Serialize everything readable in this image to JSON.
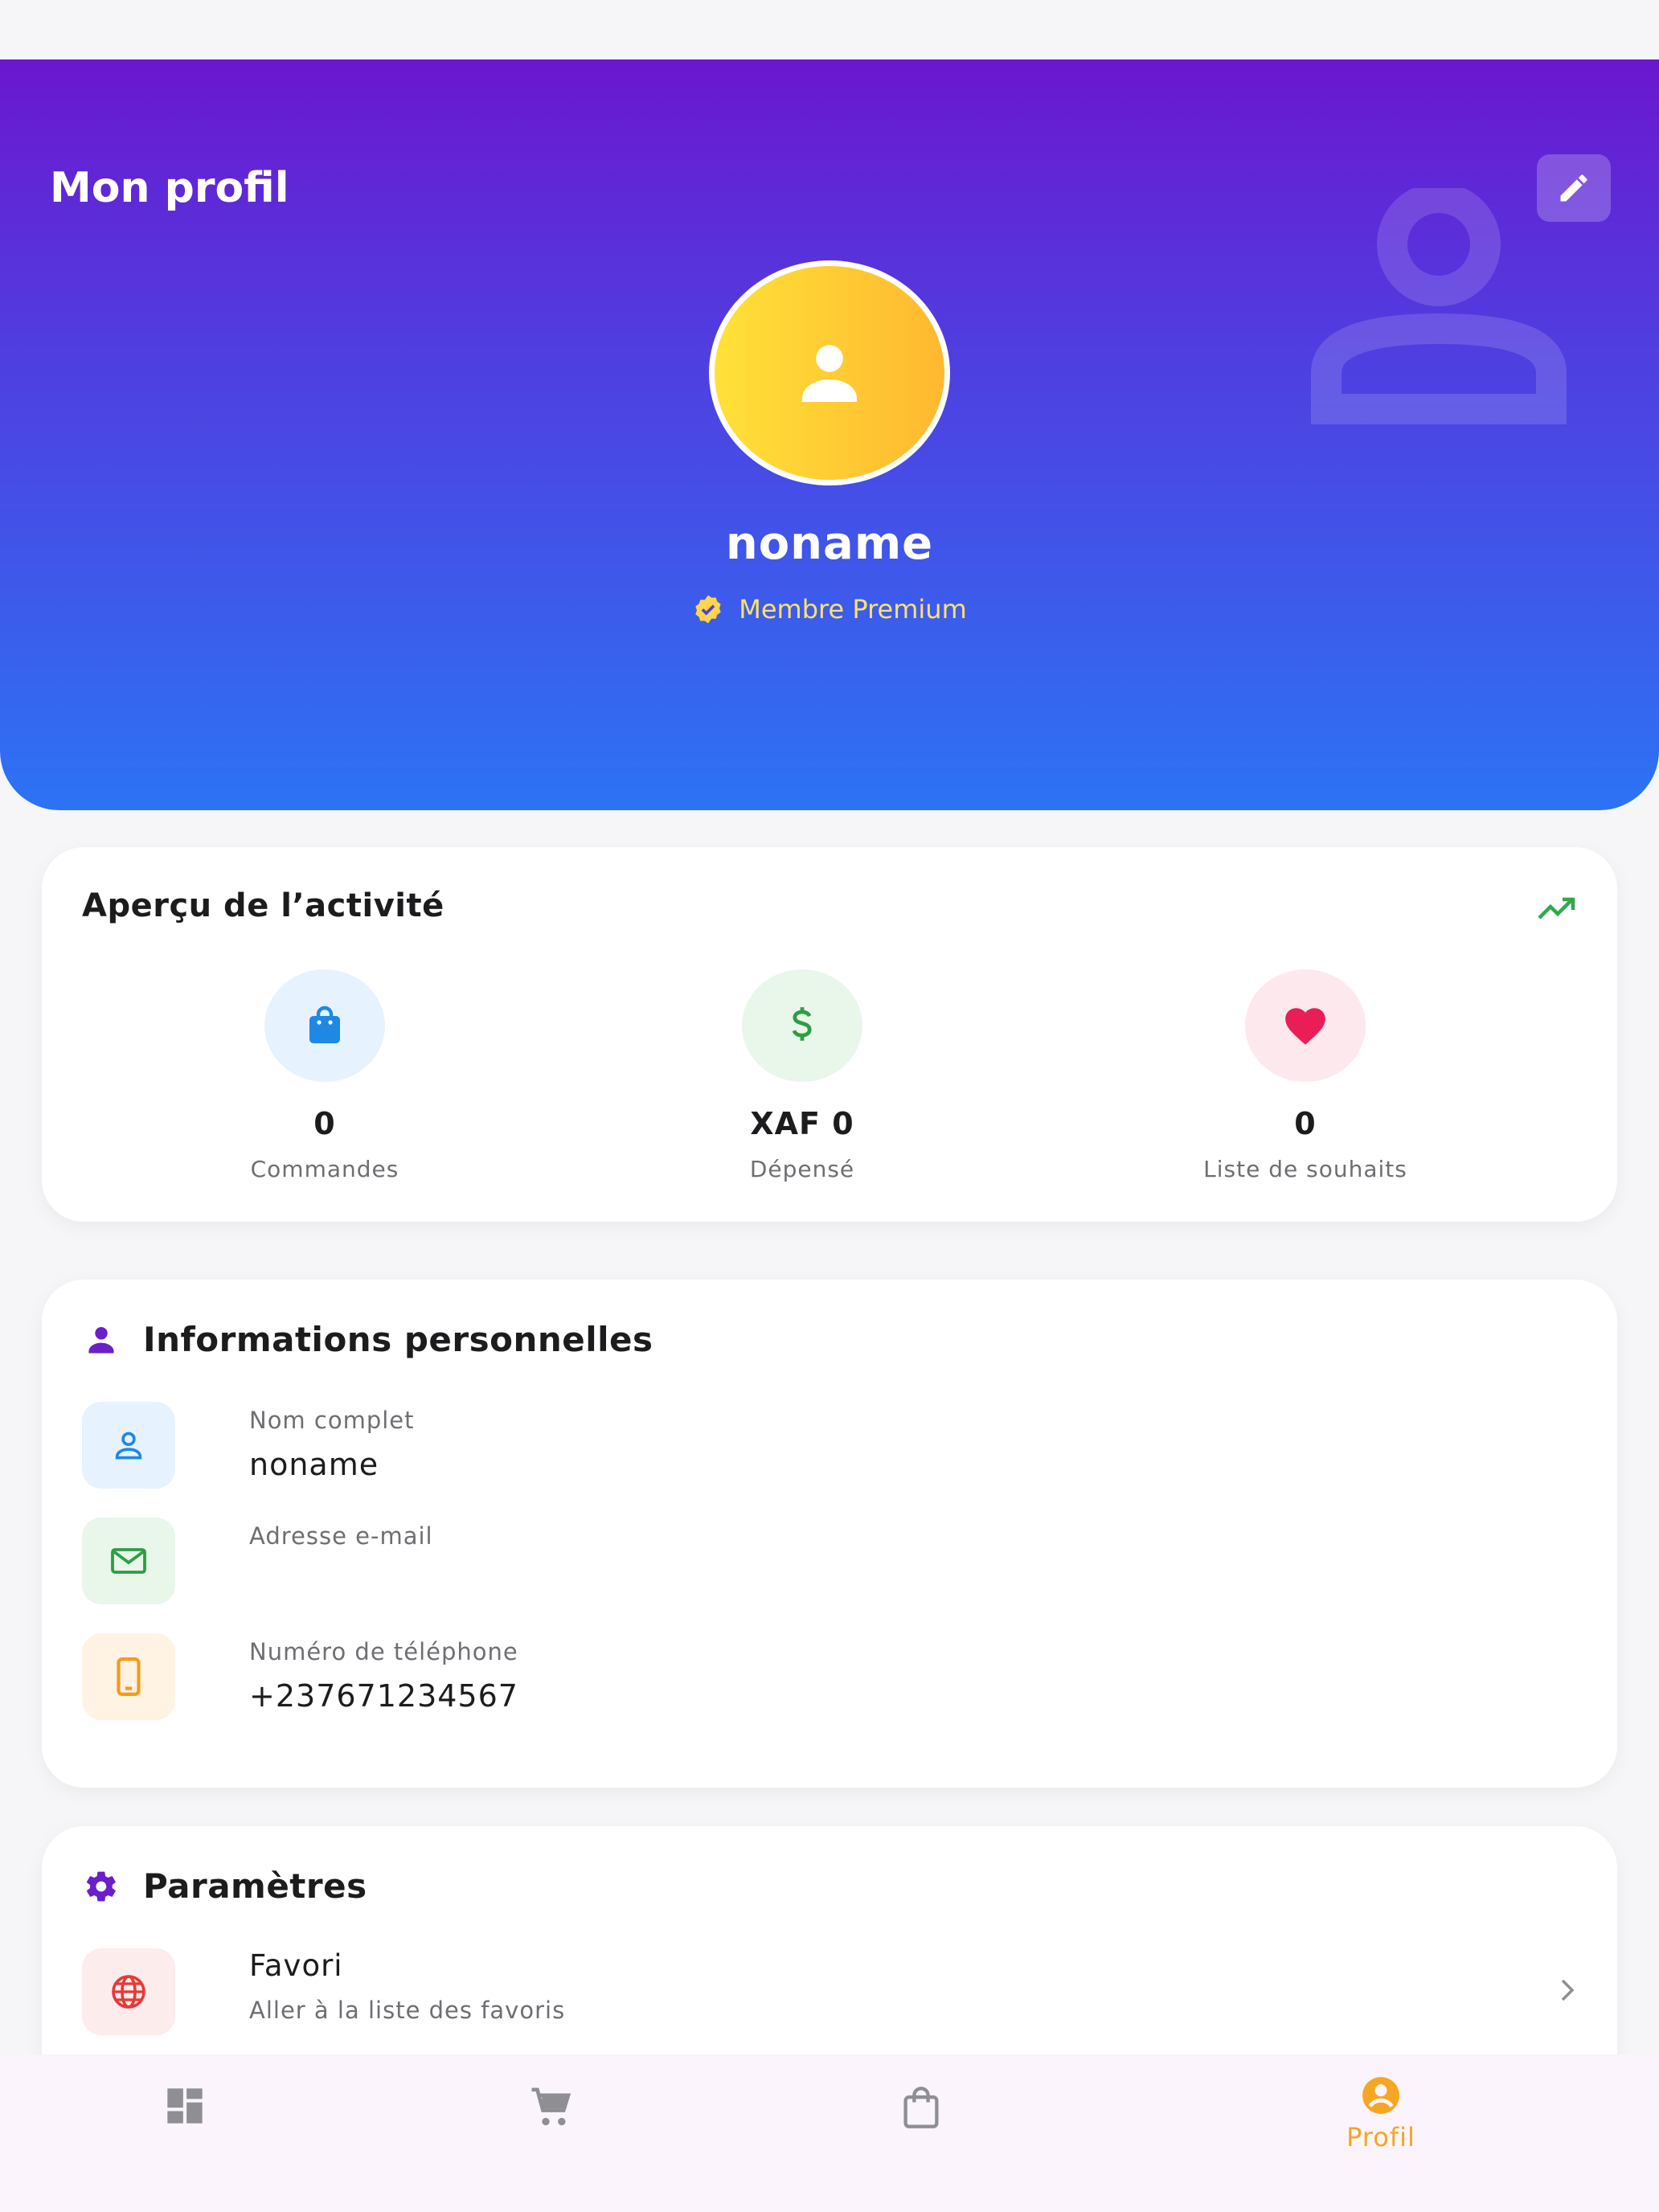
{
  "colors": {
    "header_gradient_top": "#6b17cf",
    "header_gradient_bottom": "#2c73f5",
    "accent_purple": "#6a1fc9",
    "premium_gold": "#ffe26a",
    "nav_active": "#f5a623"
  },
  "header": {
    "title": "Mon profil",
    "edit_icon": "pencil-icon",
    "username": "noname",
    "badge": "Membre Premium",
    "badge_icon": "verified-icon"
  },
  "activity": {
    "title": "Aperçu de l’activité",
    "trend_icon": "trending-up-icon",
    "stats": [
      {
        "icon": "shopping-bag-icon",
        "value": "0",
        "label": "Commandes"
      },
      {
        "icon": "dollar-icon",
        "value": "XAF 0",
        "label": "Dépensé"
      },
      {
        "icon": "heart-icon",
        "value": "0",
        "label": "Liste de souhaits"
      }
    ]
  },
  "info": {
    "title": "Informations personnelles",
    "rows": [
      {
        "icon": "person-icon",
        "label": "Nom complet",
        "value": "noname"
      },
      {
        "icon": "mail-icon",
        "label": "Adresse e-mail",
        "value": ""
      },
      {
        "icon": "phone-icon",
        "label": "Numéro de téléphone",
        "value": "+237671234567"
      }
    ]
  },
  "settings": {
    "title": "Paramètres",
    "items": [
      {
        "icon": "globe-icon",
        "title": "Favori",
        "subtitle": "Aller à la liste des favoris"
      }
    ]
  },
  "nav": {
    "items": [
      {
        "icon": "dashboard-icon",
        "label": ""
      },
      {
        "icon": "cart-icon",
        "label": ""
      },
      {
        "icon": "bag-icon",
        "label": ""
      },
      {
        "icon": "account-circle-icon",
        "label": "Profil",
        "active": true
      }
    ]
  }
}
